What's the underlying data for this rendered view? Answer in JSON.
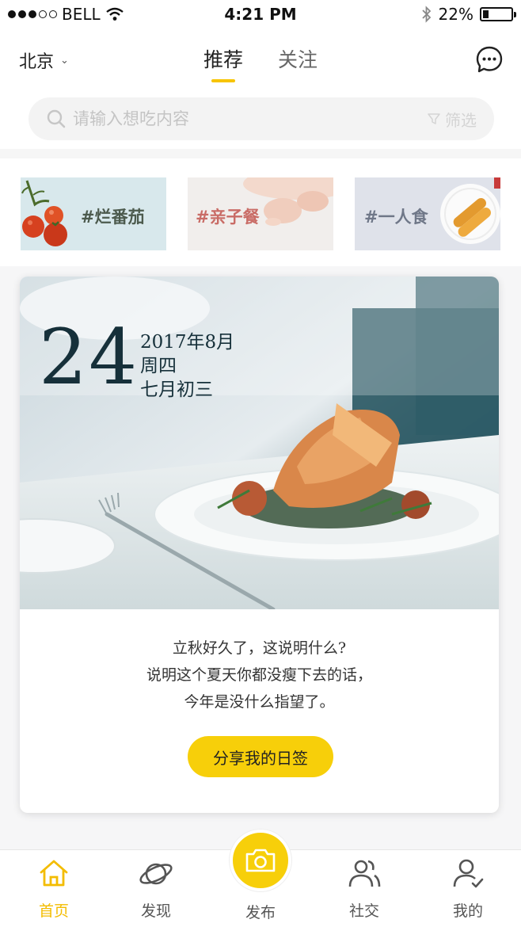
{
  "status_bar": {
    "carrier": "BELL",
    "time": "4:21 PM",
    "battery_text": "22%",
    "battery_level": 0.22,
    "signal_filled": 3,
    "signal_total": 5
  },
  "header": {
    "city": "北京",
    "tabs": [
      {
        "label": "推荐",
        "active": true
      },
      {
        "label": "关注",
        "active": false
      }
    ]
  },
  "search": {
    "placeholder": "请输入想吃内容",
    "filter_label": "筛选"
  },
  "tags": [
    {
      "label": "#烂番茄",
      "color": "#4c5a4d"
    },
    {
      "label": "#亲子餐",
      "color": "#c96c66"
    },
    {
      "label": "#一人食",
      "color": "#6f7788"
    }
  ],
  "daily_card": {
    "day": "24",
    "year_month": "2017年8月",
    "weekday": "周四",
    "lunar": "七月初三",
    "quote": [
      "立秋好久了，这说明什么?",
      "说明这个夏天你都没瘦下去的话，",
      "今年是没什么指望了。"
    ],
    "share_label": "分享我的日签"
  },
  "bottom_nav": {
    "items": [
      {
        "label": "首页",
        "icon": "home-icon",
        "active": true
      },
      {
        "label": "发现",
        "icon": "planet-icon",
        "active": false
      },
      {
        "label": "发布",
        "icon": "camera-icon",
        "active": false
      },
      {
        "label": "社交",
        "icon": "users-icon",
        "active": false
      },
      {
        "label": "我的",
        "icon": "user-check-icon",
        "active": false
      }
    ]
  },
  "colors": {
    "accent": "#f7cf0a",
    "active_nav": "#f3bc00"
  }
}
